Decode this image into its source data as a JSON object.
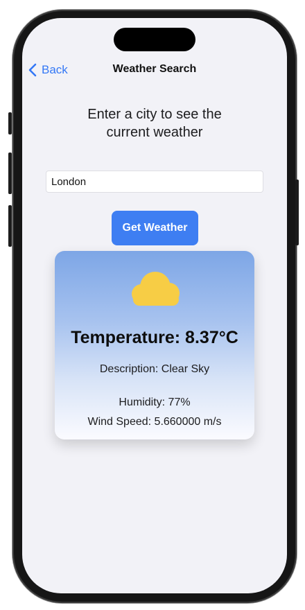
{
  "nav": {
    "back_label": "Back",
    "title": "Weather Search"
  },
  "main": {
    "prompt": "Enter a city to see the current weather",
    "city_input": {
      "value": "London",
      "placeholder": ""
    },
    "get_button_label": "Get Weather"
  },
  "weather_card": {
    "icon": "cloud-icon",
    "temperature_text": "Temperature: 8.37°C",
    "description_text": "Description: Clear Sky",
    "humidity_text": "Humidity: 77%",
    "wind_text": "Wind Speed: 5.660000 m/s"
  },
  "colors": {
    "accent": "#3478f6",
    "button": "#3e7ef2",
    "cloud": "#f7cd45",
    "screen_bg": "#f2f2f7"
  }
}
